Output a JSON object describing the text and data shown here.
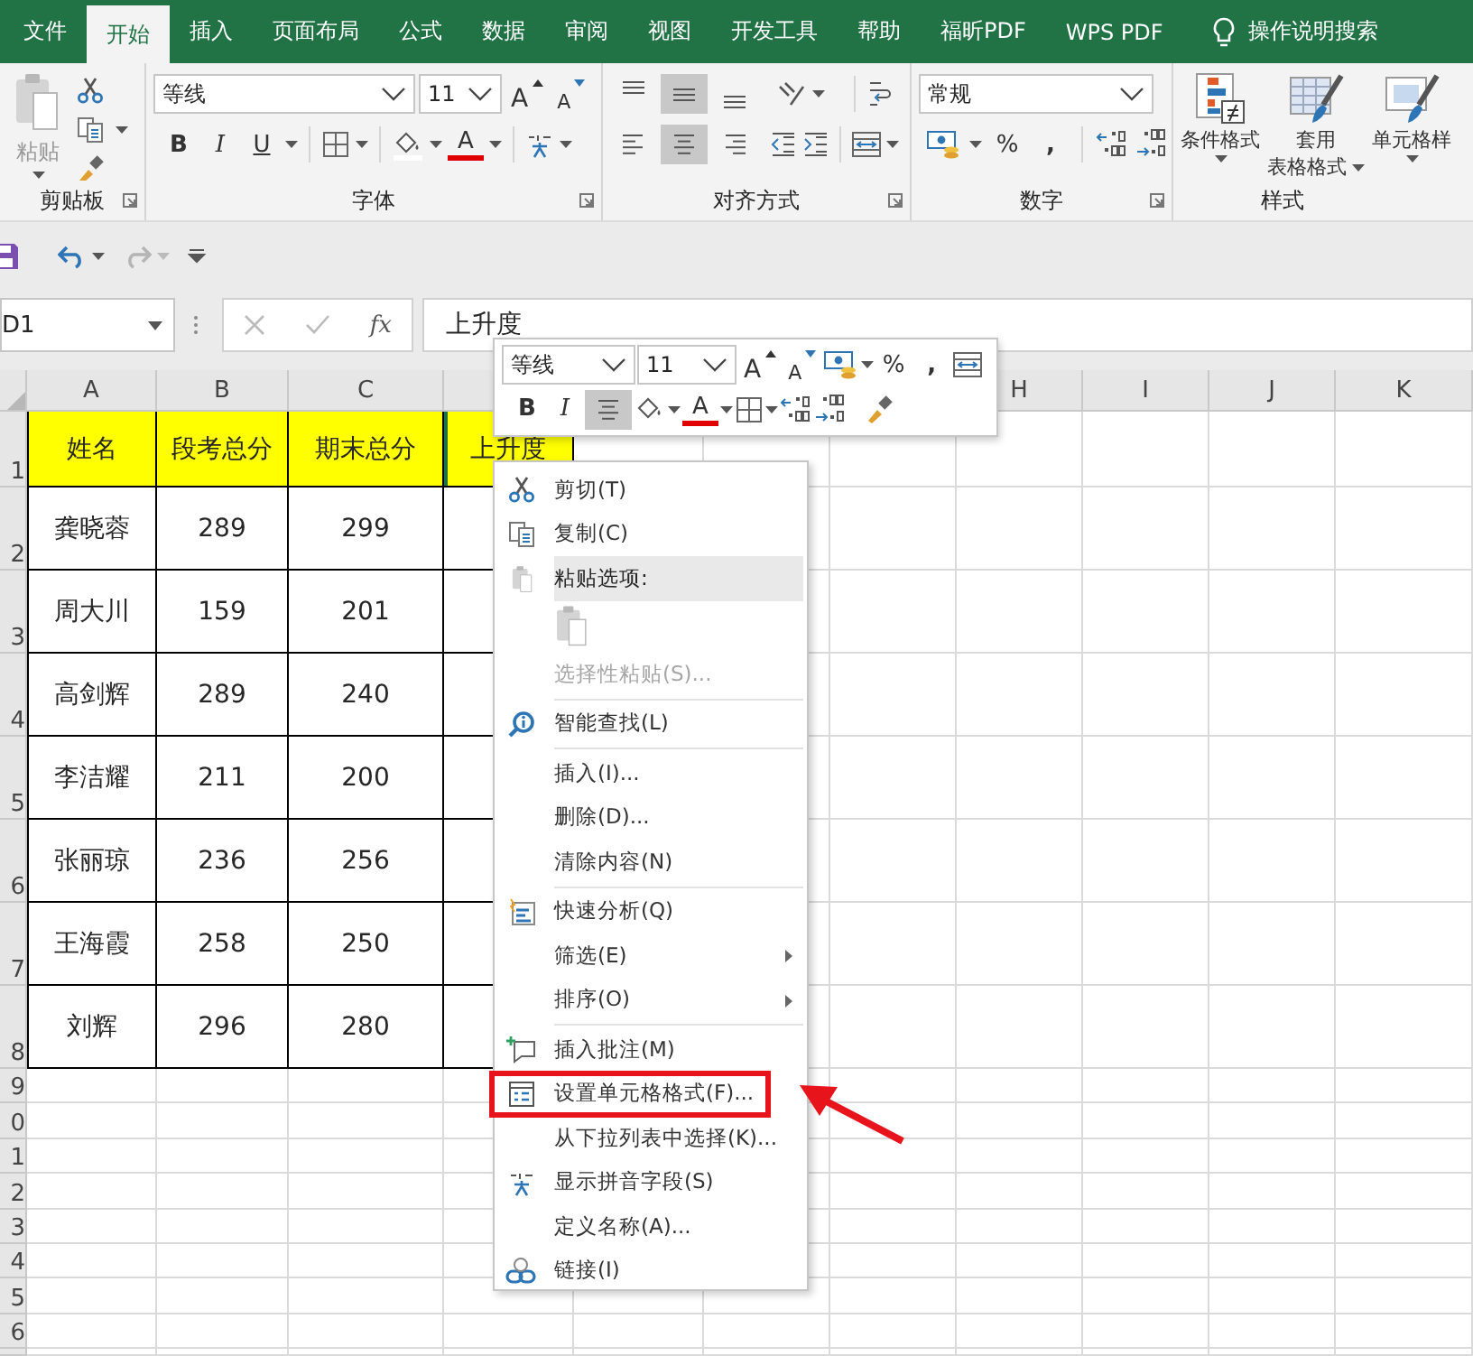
{
  "tabs": [
    {
      "label": "文件",
      "selected": false
    },
    {
      "label": "开始",
      "selected": true
    },
    {
      "label": "插入",
      "selected": false
    },
    {
      "label": "页面布局",
      "selected": false
    },
    {
      "label": "公式",
      "selected": false
    },
    {
      "label": "数据",
      "selected": false
    },
    {
      "label": "审阅",
      "selected": false
    },
    {
      "label": "视图",
      "selected": false
    },
    {
      "label": "开发工具",
      "selected": false
    },
    {
      "label": "帮助",
      "selected": false
    },
    {
      "label": "福昕PDF",
      "selected": false
    },
    {
      "label": "WPS PDF",
      "selected": false
    }
  ],
  "tell_me": "操作说明搜索",
  "clipboard": {
    "paste": "粘贴",
    "label": "剪贴板"
  },
  "font": {
    "name": "等线",
    "size": "11",
    "grow": "A",
    "shrink": "A",
    "bold": "B",
    "italic": "I",
    "underline": "U",
    "font_color_label": "A",
    "label": "字体"
  },
  "alignment": {
    "vertical": [
      {
        "selected": false
      },
      {
        "selected": true
      },
      {
        "selected": false
      }
    ],
    "horizontal": [
      {
        "selected": false
      },
      {
        "selected": true
      },
      {
        "selected": false
      }
    ],
    "label": "对齐方式"
  },
  "number": {
    "format": "常规",
    "percent": "%",
    "comma": ",",
    "label": "数字"
  },
  "styles": {
    "buttons": [
      {
        "lines": [
          "条件格式"
        ]
      },
      {
        "lines": [
          "套用",
          "表格格式"
        ]
      },
      {
        "lines": [
          "单元格样"
        ]
      }
    ],
    "label": "样式"
  },
  "name_box": "D1",
  "function_label": "fx",
  "formula": "上升度",
  "columns_left": [
    "A",
    "B",
    "C"
  ],
  "columns_right": [
    "H",
    "I",
    "J",
    "K"
  ],
  "row_numbers": [
    "1",
    "2",
    "3",
    "4",
    "5",
    "6",
    "7",
    "8",
    "9",
    "0",
    "1",
    "2",
    "3",
    "4",
    "5",
    "6"
  ],
  "table": {
    "header": [
      "姓名",
      "段考总分",
      "期末总分",
      "上升度"
    ],
    "rows": [
      [
        "龚晓蓉",
        "289",
        "299"
      ],
      [
        "周大川",
        "159",
        "201"
      ],
      [
        "高剑辉",
        "289",
        "240"
      ],
      [
        "李洁耀",
        "211",
        "200"
      ],
      [
        "张丽琼",
        "236",
        "256"
      ],
      [
        "王海霞",
        "258",
        "250"
      ],
      [
        "刘辉",
        "296",
        "280"
      ]
    ]
  },
  "mini_toolbar": {
    "font": "等线",
    "size": "11",
    "grow": "A",
    "shrink": "A",
    "percent": "%",
    "comma": ",",
    "bold": "B",
    "italic": "I",
    "center_selected": true,
    "font_color_label": "A"
  },
  "context_menu": [
    {
      "kind": "item",
      "label": "剪切(T)",
      "disabled": false,
      "submenu": false,
      "highlighted": false
    },
    {
      "kind": "item",
      "label": "复制(C)",
      "disabled": false,
      "submenu": false,
      "highlighted": false
    },
    {
      "kind": "header",
      "label": "粘贴选项:"
    },
    {
      "kind": "paste_options"
    },
    {
      "kind": "item",
      "label": "选择性粘贴(S)...",
      "disabled": true,
      "submenu": false,
      "highlighted": false
    },
    {
      "kind": "separator"
    },
    {
      "kind": "item",
      "label": "智能查找(L)",
      "disabled": false,
      "submenu": false,
      "highlighted": false
    },
    {
      "kind": "separator"
    },
    {
      "kind": "item",
      "label": "插入(I)...",
      "disabled": false,
      "submenu": false,
      "highlighted": false
    },
    {
      "kind": "item",
      "label": "删除(D)...",
      "disabled": false,
      "submenu": false,
      "highlighted": false
    },
    {
      "kind": "item",
      "label": "清除内容(N)",
      "disabled": false,
      "submenu": false,
      "highlighted": false
    },
    {
      "kind": "separator"
    },
    {
      "kind": "item",
      "label": "快速分析(Q)",
      "disabled": false,
      "submenu": false,
      "highlighted": false
    },
    {
      "kind": "item",
      "label": "筛选(E)",
      "disabled": false,
      "submenu": true,
      "highlighted": false
    },
    {
      "kind": "item",
      "label": "排序(O)",
      "disabled": false,
      "submenu": true,
      "highlighted": false
    },
    {
      "kind": "separator"
    },
    {
      "kind": "item",
      "label": "插入批注(M)",
      "disabled": false,
      "submenu": false,
      "highlighted": false
    },
    {
      "kind": "item",
      "label": "设置单元格格式(F)...",
      "disabled": false,
      "submenu": false,
      "highlighted": true
    },
    {
      "kind": "item",
      "label": "从下拉列表中选择(K)...",
      "disabled": false,
      "submenu": false,
      "highlighted": false
    },
    {
      "kind": "item",
      "label": "显示拼音字段(S)",
      "disabled": false,
      "submenu": false,
      "highlighted": false
    },
    {
      "kind": "item",
      "label": "定义名称(A)...",
      "disabled": false,
      "submenu": false,
      "highlighted": false
    },
    {
      "kind": "item",
      "label": "链接(I)",
      "disabled": false,
      "submenu": false,
      "highlighted": false
    }
  ]
}
